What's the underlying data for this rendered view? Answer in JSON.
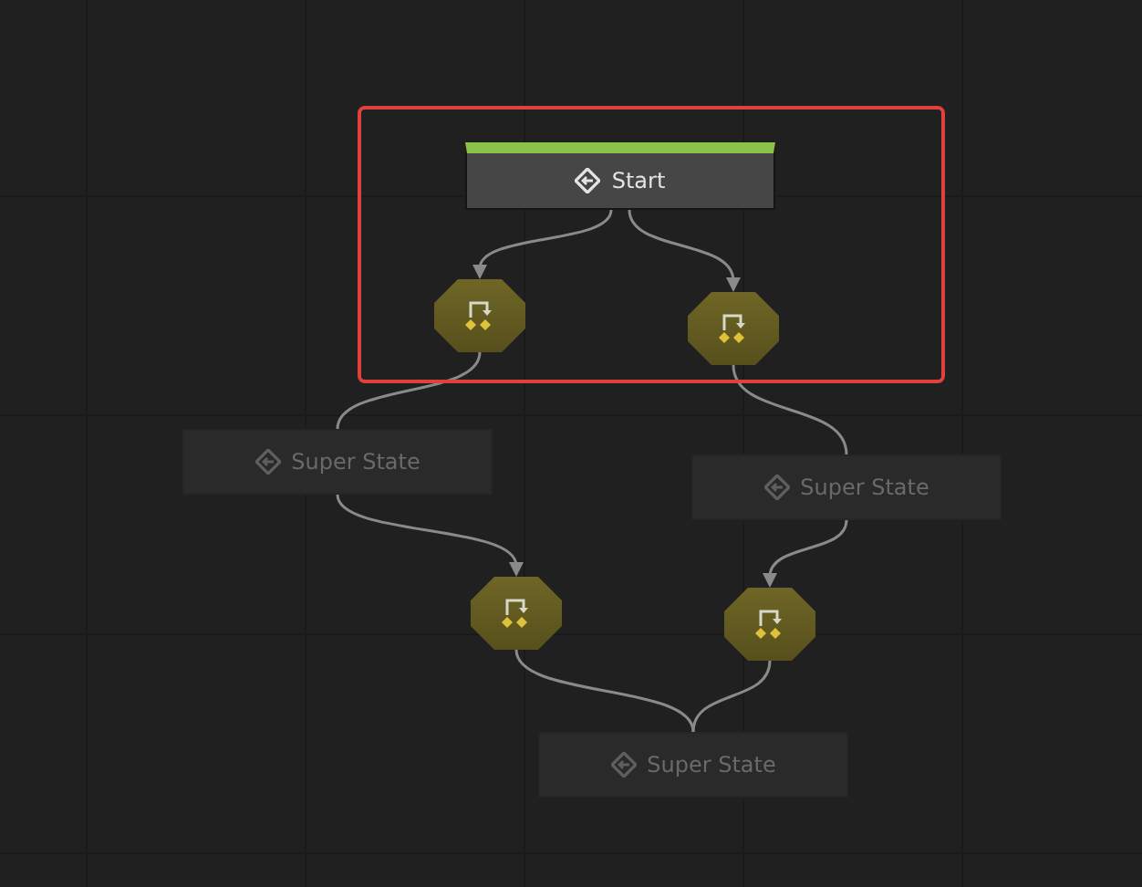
{
  "nodes": [
    {
      "kind": "start",
      "label": "Start",
      "disabled": false
    },
    {
      "kind": "transition",
      "disabled": false
    },
    {
      "kind": "transition",
      "disabled": false
    },
    {
      "kind": "super_state",
      "label": "Super State",
      "disabled": true
    },
    {
      "kind": "super_state",
      "label": "Super State",
      "disabled": true
    },
    {
      "kind": "transition",
      "disabled": false
    },
    {
      "kind": "transition",
      "disabled": false
    },
    {
      "kind": "super_state",
      "label": "Super State",
      "disabled": true
    }
  ]
}
